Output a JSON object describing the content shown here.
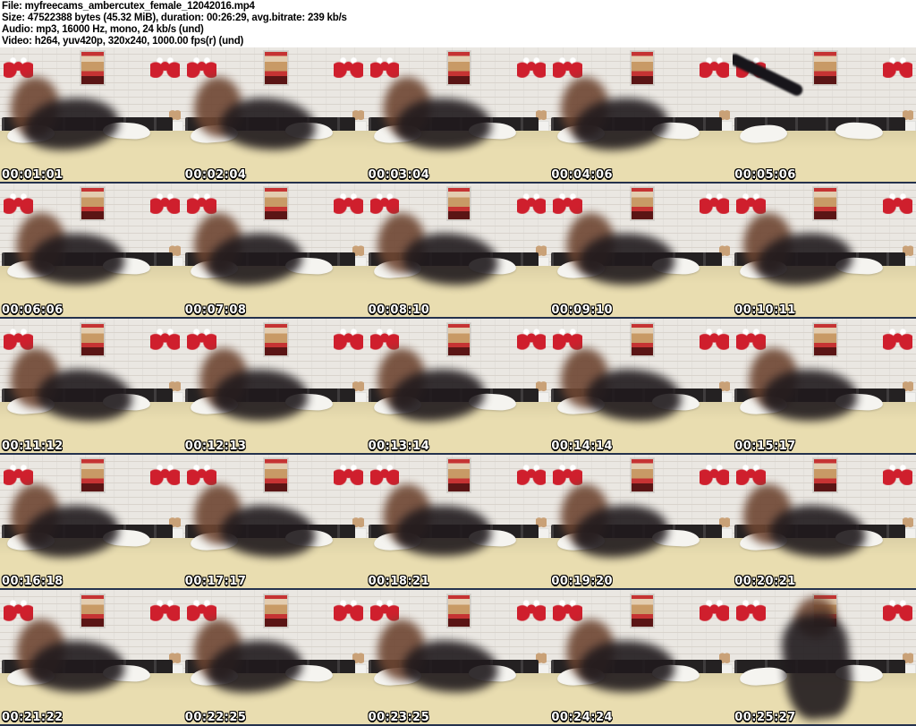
{
  "header": {
    "file_line": "File: myfreecams_ambercutex_female_12042016.mp4",
    "size_line": "Size: 47522388 bytes (45.32 MiB), duration: 00:26:29, avg.bitrate: 239 kb/s",
    "audio_line": "Audio: mp3, 16000 Hz, mono, 24 kb/s (und)",
    "video_line": "Video: h264, yuv420p, 320x240, 1000.00 fps(r) (und)"
  },
  "grid": {
    "columns": 5,
    "rows": 5
  },
  "frames": [
    {
      "timestamp": "00:01:01",
      "variant": "default"
    },
    {
      "timestamp": "00:02:04",
      "variant": "default"
    },
    {
      "timestamp": "00:03:04",
      "variant": "default"
    },
    {
      "timestamp": "00:04:06",
      "variant": "default"
    },
    {
      "timestamp": "00:05:06",
      "variant": "empty-bed"
    },
    {
      "timestamp": "00:06:06",
      "variant": "default"
    },
    {
      "timestamp": "00:07:08",
      "variant": "default"
    },
    {
      "timestamp": "00:08:10",
      "variant": "default"
    },
    {
      "timestamp": "00:09:10",
      "variant": "default"
    },
    {
      "timestamp": "00:10:11",
      "variant": "default"
    },
    {
      "timestamp": "00:11:12",
      "variant": "default"
    },
    {
      "timestamp": "00:12:13",
      "variant": "default"
    },
    {
      "timestamp": "00:13:14",
      "variant": "default"
    },
    {
      "timestamp": "00:14:14",
      "variant": "default"
    },
    {
      "timestamp": "00:15:17",
      "variant": "default"
    },
    {
      "timestamp": "00:16:18",
      "variant": "default"
    },
    {
      "timestamp": "00:17:17",
      "variant": "default"
    },
    {
      "timestamp": "00:18:21",
      "variant": "default"
    },
    {
      "timestamp": "00:19:20",
      "variant": "default"
    },
    {
      "timestamp": "00:20:21",
      "variant": "default"
    },
    {
      "timestamp": "00:21:22",
      "variant": "default"
    },
    {
      "timestamp": "00:22:25",
      "variant": "default"
    },
    {
      "timestamp": "00:23:25",
      "variant": "default"
    },
    {
      "timestamp": "00:24:24",
      "variant": "default"
    },
    {
      "timestamp": "00:25:27",
      "variant": "standing"
    }
  ],
  "palette": {
    "page_background": "#ffffff",
    "header_text": "#000000",
    "wall": "#eae7e2",
    "brick_line": "#d9d4cd",
    "headboard": "#242122",
    "bed": "#e9ddb0",
    "pillow": "#f5f4f0",
    "accent_red": "#cf1f2d",
    "poster_tan": "#c89a66",
    "timestamp_text": "#ffffff",
    "timestamp_outline": "#000000",
    "frame_bottom_line": "#25324d"
  }
}
